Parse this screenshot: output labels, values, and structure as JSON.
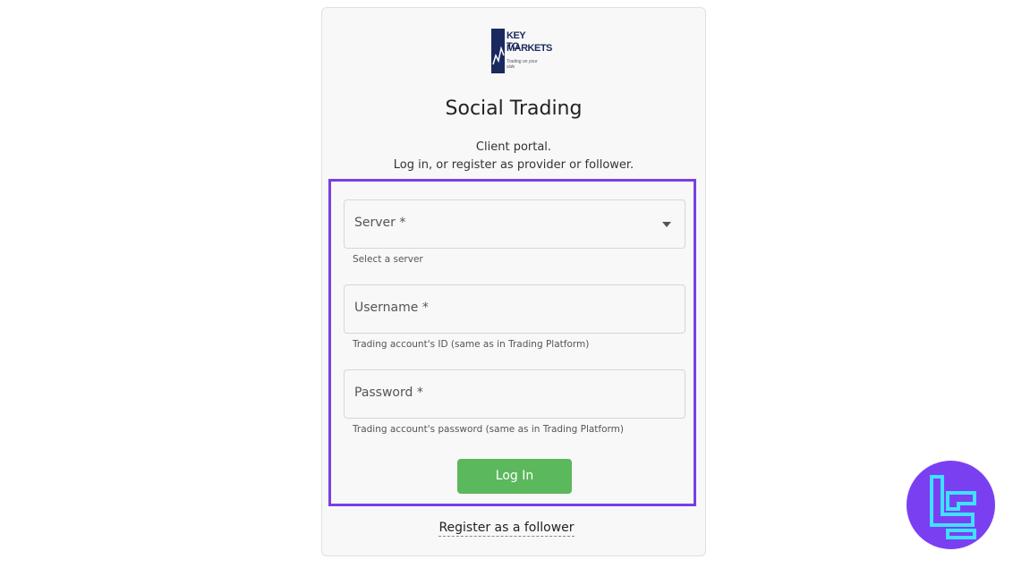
{
  "logo": {
    "line1": "KEY TO",
    "line2": "MARKETS",
    "line3": "Trading on your side"
  },
  "header": {
    "title": "Social Trading",
    "subtitle_line1": "Client portal.",
    "subtitle_line2": "Log in, or register as provider or follower."
  },
  "form": {
    "server": {
      "label": "Server *",
      "hint": "Select a server"
    },
    "username": {
      "label": "Username *",
      "hint": "Trading account's ID (same as in Trading Platform)"
    },
    "password": {
      "label": "Password *",
      "hint": "Trading account's password (same as in Trading Platform)"
    },
    "login_label": "Log In"
  },
  "footer": {
    "register_label": "Register as a follower"
  },
  "colors": {
    "highlight": "#7a3fe0",
    "button": "#5cb85c",
    "badge": "#7b3ff2",
    "badge_glyph": "#40e0ff"
  }
}
